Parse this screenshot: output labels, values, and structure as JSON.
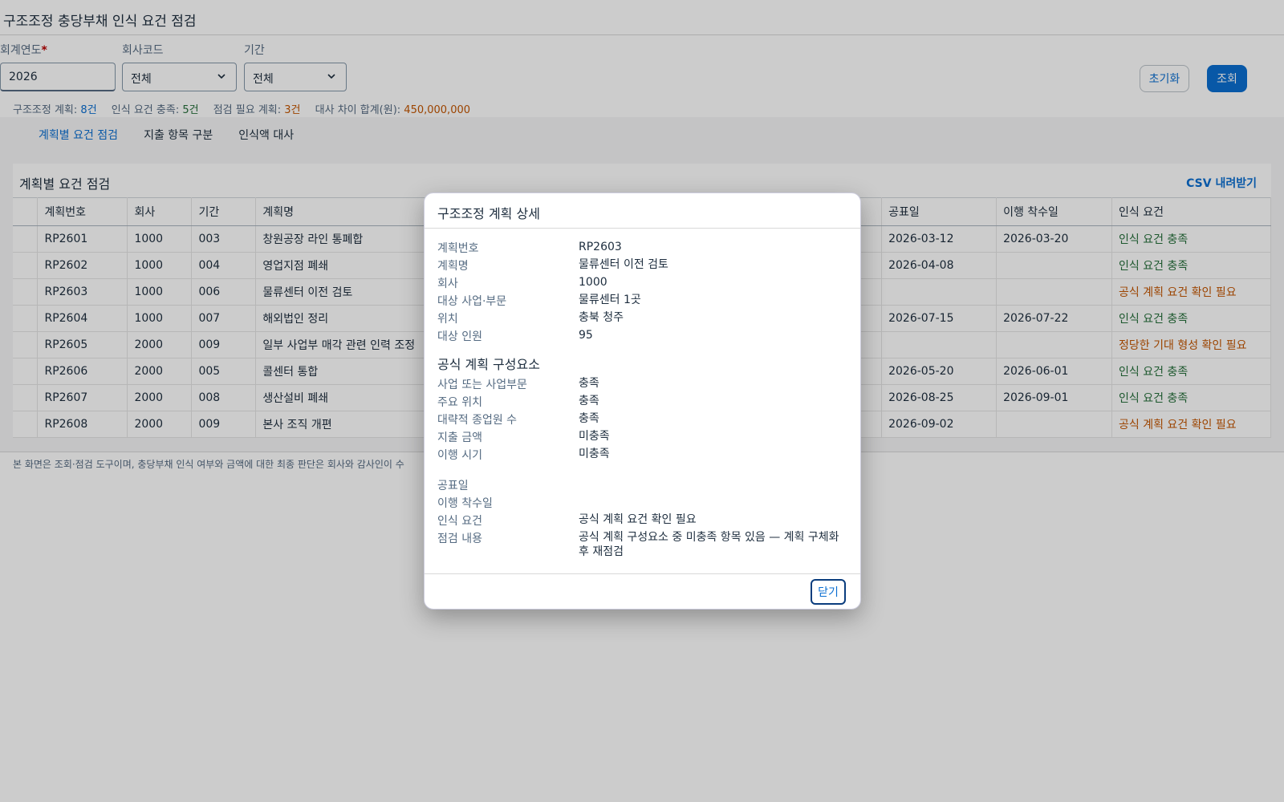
{
  "header": {
    "title": "구조조정 충당부채 인식 요건 점검"
  },
  "filters": {
    "year": {
      "label": "회계연도",
      "required_mark": "*",
      "value": "2026"
    },
    "company": {
      "label": "회사코드",
      "value": "전체"
    },
    "period": {
      "label": "기간",
      "value": "전체"
    },
    "reset_label": "초기화",
    "search_label": "조회"
  },
  "summary": {
    "plans_label": "구조조정 계획:",
    "plans_value": "8건",
    "met_label": "인식 요건 충족:",
    "met_value": "5건",
    "check_label": "점검 필요 계획:",
    "check_value": "3건",
    "diff_label": "대사 차이 합계(원):",
    "diff_value": "450,000,000"
  },
  "tabs": [
    "계획별 요건 점검",
    "지출 항목 구분",
    "인식액 대사"
  ],
  "panel": {
    "title": "계획별 요건 점검",
    "csv_label": "CSV 내려받기"
  },
  "table": {
    "columns": [
      "계획번호",
      "회사",
      "기간",
      "계획명",
      "공표일",
      "이행 착수일",
      "인식 요건"
    ],
    "rows": [
      {
        "id": "RP2601",
        "company": "1000",
        "period": "003",
        "name": "창원공장 라인 통폐합",
        "announce": "2026-03-12",
        "start": "2026-03-20",
        "status": "인식 요건 충족",
        "status_type": "ok"
      },
      {
        "id": "RP2602",
        "company": "1000",
        "period": "004",
        "name": "영업지점 폐쇄",
        "announce": "2026-04-08",
        "start": "",
        "status": "인식 요건 충족",
        "status_type": "ok"
      },
      {
        "id": "RP2603",
        "company": "1000",
        "period": "006",
        "name": "물류센터 이전 검토",
        "announce": "",
        "start": "",
        "status": "공식 계획 요건 확인 필요",
        "status_type": "warn"
      },
      {
        "id": "RP2604",
        "company": "1000",
        "period": "007",
        "name": "해외법인 정리",
        "announce": "2026-07-15",
        "start": "2026-07-22",
        "status": "인식 요건 충족",
        "status_type": "ok"
      },
      {
        "id": "RP2605",
        "company": "2000",
        "period": "009",
        "name": "일부 사업부 매각 관련 인력 조정",
        "announce": "",
        "start": "",
        "status": "정당한 기대 형성 확인 필요",
        "status_type": "warn"
      },
      {
        "id": "RP2606",
        "company": "2000",
        "period": "005",
        "name": "콜센터 통합",
        "announce": "2026-05-20",
        "start": "2026-06-01",
        "status": "인식 요건 충족",
        "status_type": "ok"
      },
      {
        "id": "RP2607",
        "company": "2000",
        "period": "008",
        "name": "생산설비 폐쇄",
        "announce": "2026-08-25",
        "start": "2026-09-01",
        "status": "인식 요건 충족",
        "status_type": "ok"
      },
      {
        "id": "RP2608",
        "company": "2000",
        "period": "009",
        "name": "본사 조직 개편",
        "announce": "2026-09-02",
        "start": "",
        "status": "공식 계획 요건 확인 필요",
        "status_type": "warn"
      }
    ]
  },
  "footnote": "본 화면은 조회·점검 도구이며, 충당부채 인식 여부와 금액에 대한 최종 판단은 회사와 감사인이 수",
  "dialog": {
    "title": "구조조정 계획 상세",
    "fields": [
      {
        "label": "계획번호",
        "value": "RP2603"
      },
      {
        "label": "계획명",
        "value": "물류센터 이전 검토"
      },
      {
        "label": "회사",
        "value": "1000"
      },
      {
        "label": "대상 사업·부문",
        "value": "물류센터 1곳"
      },
      {
        "label": "위치",
        "value": "충북 청주"
      },
      {
        "label": "대상 인원",
        "value": "95"
      }
    ],
    "components_title": "공식 계획 구성요소",
    "components": [
      {
        "label": "사업 또는 사업부문",
        "value": "충족",
        "type": "ok"
      },
      {
        "label": "주요 위치",
        "value": "충족",
        "type": "ok"
      },
      {
        "label": "대략적 종업원 수",
        "value": "충족",
        "type": "ok"
      },
      {
        "label": "지출 금액",
        "value": "미충족",
        "type": "warn"
      },
      {
        "label": "이행 시기",
        "value": "미충족",
        "type": "warn"
      }
    ],
    "extra": [
      {
        "label": "공표일",
        "value": "",
        "type": ""
      },
      {
        "label": "이행 착수일",
        "value": "",
        "type": ""
      },
      {
        "label": "인식 요건",
        "value": "공식 계획 요건 확인 필요",
        "type": "warn"
      },
      {
        "label": "점검 내용",
        "value": "공식 계획 구성요소 중 미충족 항목 있음 — 계획 구체화 후 재점검",
        "type": ""
      }
    ],
    "close_label": "닫기"
  },
  "colors": {
    "accent": "#0a6ed1",
    "ok": "#256f3a",
    "warn": "#c35500"
  }
}
